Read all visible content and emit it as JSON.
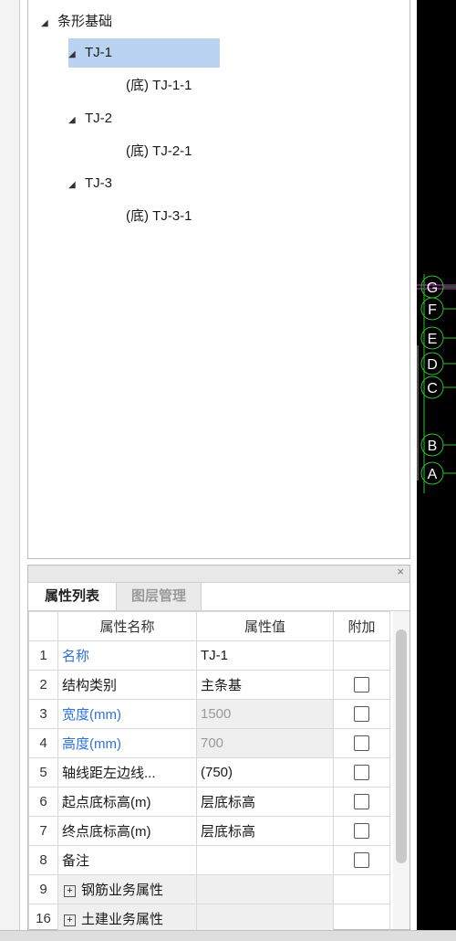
{
  "tree": {
    "root": "条形基础",
    "items": [
      {
        "label": "TJ-1",
        "child": "(底) TJ-1-1"
      },
      {
        "label": "TJ-2",
        "child": "(底) TJ-2-1"
      },
      {
        "label": "TJ-3",
        "child": "(底) TJ-3-1"
      }
    ]
  },
  "canvas": {
    "axis_labels": [
      "G",
      "F",
      "E",
      "D",
      "C",
      "B",
      "A"
    ]
  },
  "panel": {
    "close": "×",
    "tabs": [
      "属性列表",
      "图层管理"
    ],
    "columns": [
      "属性名称",
      "属性值",
      "附加"
    ],
    "rows": [
      {
        "no": "1",
        "name": "名称",
        "value": "TJ-1"
      },
      {
        "no": "2",
        "name": "结构类别",
        "value": "主条基"
      },
      {
        "no": "3",
        "name": "宽度(mm)",
        "value": "1500"
      },
      {
        "no": "4",
        "name": "高度(mm)",
        "value": "700"
      },
      {
        "no": "5",
        "name": "轴线距左边线...",
        "value": "(750)"
      },
      {
        "no": "6",
        "name": "起点底标高(m)",
        "value": "层底标高"
      },
      {
        "no": "7",
        "name": "终点底标高(m)",
        "value": "层底标高"
      },
      {
        "no": "8",
        "name": "备注",
        "value": ""
      },
      {
        "no": "9",
        "name": "钢筋业务属性",
        "value": ""
      },
      {
        "no": "16",
        "name": "土建业务属性",
        "value": ""
      }
    ]
  },
  "colors": {
    "selection": "#b9d3f0",
    "link_blue": "#2f73d9",
    "axis_green": "#2fbf2f"
  }
}
